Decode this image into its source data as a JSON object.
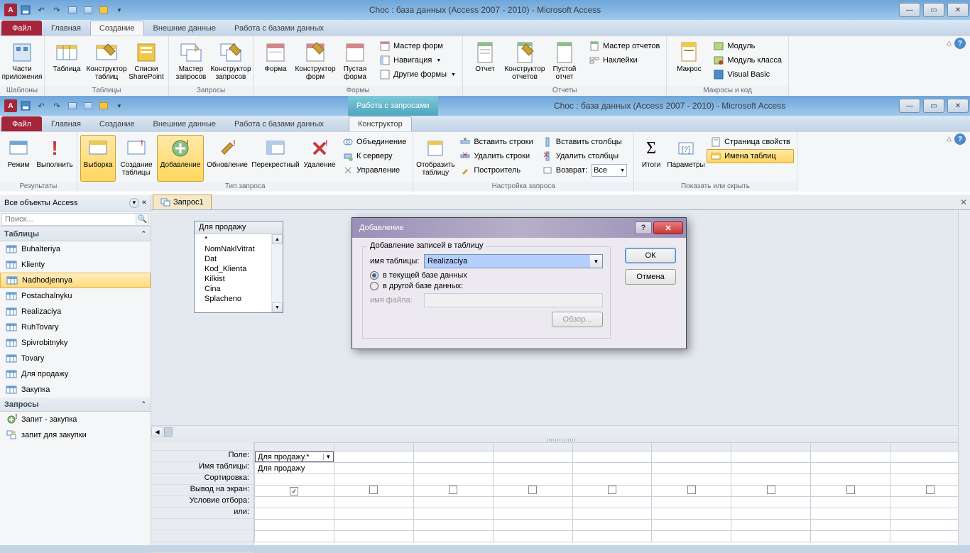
{
  "app_title": "Choc : база данных (Access 2007 - 2010)  -  Microsoft Access",
  "win1": {
    "tabs": {
      "file": "Файл",
      "home": "Главная",
      "create": "Создание",
      "ext": "Внешние данные",
      "db": "Работа с базами данных"
    },
    "groups": {
      "templates": {
        "label": "Шаблоны",
        "parts": "Части\nприложения"
      },
      "tables": {
        "label": "Таблицы",
        "table": "Таблица",
        "design": "Конструктор\nтаблиц",
        "sp": "Списки\nSharePoint"
      },
      "queries": {
        "label": "Запросы",
        "wiz": "Мастер\nзапросов",
        "design": "Конструктор\nзапросов"
      },
      "forms": {
        "label": "Формы",
        "form": "Форма",
        "design": "Конструктор\nформ",
        "blank": "Пустая\nформа",
        "wiz": "Мастер форм",
        "nav": "Навигация",
        "other": "Другие формы"
      },
      "reports": {
        "label": "Отчеты",
        "report": "Отчет",
        "design": "Конструктор\nотчетов",
        "blank": "Пустой\nотчет",
        "wiz": "Мастер отчетов",
        "labels": "Наклейки"
      },
      "macros": {
        "label": "Макросы и код",
        "macro": "Макрос",
        "module": "Модуль",
        "class": "Модуль класса",
        "vb": "Visual Basic"
      }
    }
  },
  "win2": {
    "context_title": "Работа с запросами",
    "tabs": {
      "file": "Файл",
      "home": "Главная",
      "create": "Создание",
      "ext": "Внешние данные",
      "db": "Работа с базами данных",
      "ctx": "Конструктор"
    },
    "groups": {
      "results": {
        "label": "Результаты",
        "view": "Режим",
        "run": "Выполнить"
      },
      "qtype": {
        "label": "Тип запроса",
        "select": "Выборка",
        "make": "Создание\nтаблицы",
        "append": "Добавление",
        "update": "Обновление",
        "cross": "Перекрестный",
        "delete": "Удаление",
        "union": "Объединение",
        "server": "К серверу",
        "mgmt": "Управление"
      },
      "setup": {
        "label": "Настройка запроса",
        "show": "Отобразить\nтаблицу",
        "insrow": "Вставить строки",
        "delrow": "Удалить строки",
        "builder": "Построитель",
        "inscol": "Вставить столбцы",
        "delcol": "Удалить столбцы",
        "return": "Возврат:",
        "return_val": "Все"
      },
      "showhide": {
        "label": "Показать или скрыть",
        "totals": "Итоги",
        "params": "Параметры",
        "props": "Страница свойств",
        "names": "Имена таблиц"
      }
    }
  },
  "nav": {
    "header": "Все объекты Access",
    "search_ph": "Поиск...",
    "g_tables": "Таблицы",
    "g_queries": "Запросы",
    "tables": [
      "Buhalteriya",
      "Klienty",
      "Nadhodjennya",
      "Postachalnyku",
      "Realizaciya",
      "RuhTovary",
      "Spivrobitnyky",
      "Tovary",
      "Для продажу",
      "Закупка"
    ],
    "queries": [
      "Запит - закупка",
      "запит для закупки"
    ],
    "selected": "Nadhodjennya"
  },
  "doc": {
    "tab": "Запрос1"
  },
  "fieldlist": {
    "title": "Для продажу",
    "items": [
      "*",
      "NomNaklVitrat",
      "Dat",
      "Kod_Klienta",
      "Kilkist",
      "Cina",
      "Splacheno"
    ]
  },
  "grid": {
    "labels": {
      "field": "Поле:",
      "table": "Имя таблицы:",
      "sort": "Сортировка:",
      "show": "Вывод на экран:",
      "criteria": "Условие отбора:",
      "or": "или:"
    },
    "col1": {
      "field": "Для продажу.*",
      "table": "Для продажу",
      "show": true
    }
  },
  "dialog": {
    "title": "Добавление",
    "group": "Добавление записей в таблицу",
    "tbl_label": "имя таблицы:",
    "tbl_value": "Realizaciya",
    "opt1": "в текущей базе данных",
    "opt2": "в другой базе данных:",
    "file_label": "имя файла:",
    "browse": "Обзор...",
    "ok": "ОК",
    "cancel": "Отмена"
  }
}
